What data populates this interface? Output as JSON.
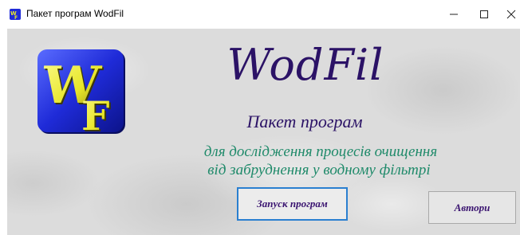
{
  "window": {
    "title": "Пакет програм  WodFil",
    "controls": [
      "minimize",
      "maximize",
      "close"
    ]
  },
  "main": {
    "app_name": "WodFil",
    "subtitle": "Пакет програм",
    "description_line1": "для дослідження процесів очищення",
    "description_line2": "від забруднення у водному фільтрі",
    "logo": {
      "letters_top": "W",
      "letters_bottom": "F",
      "name": "wodfil-logo"
    }
  },
  "buttons": {
    "launch_label": "Запуск програм",
    "authors_label": "Автори"
  },
  "colors": {
    "title_purple": "#2b1266",
    "description_green": "#1f8a6a",
    "logo_blue": "#1f2bd8",
    "logo_yellow": "#e8e62a",
    "focus_border": "#2a7fd0"
  }
}
